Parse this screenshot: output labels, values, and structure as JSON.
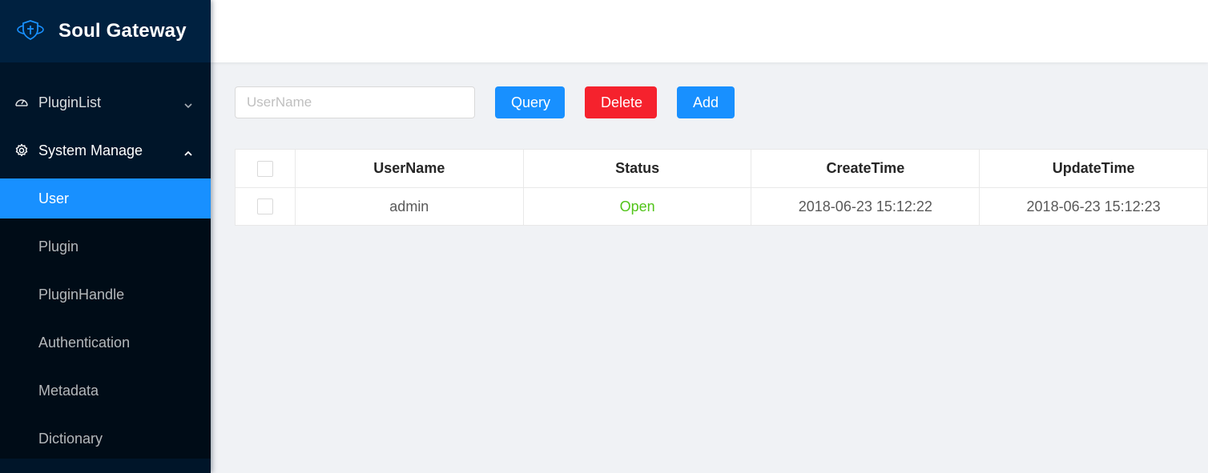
{
  "app": {
    "brand": "Soul Gateway"
  },
  "sidebar": {
    "menus": [
      {
        "label": "PluginList",
        "icon": "dashboard-icon",
        "expanded": false
      },
      {
        "label": "System Manage",
        "icon": "gear-icon",
        "expanded": true
      }
    ],
    "submenu": [
      {
        "label": "User",
        "active": true
      },
      {
        "label": "Plugin"
      },
      {
        "label": "PluginHandle"
      },
      {
        "label": "Authentication"
      },
      {
        "label": "Metadata"
      },
      {
        "label": "Dictionary"
      }
    ]
  },
  "toolbar": {
    "search_placeholder": "UserName",
    "search_value": "",
    "query_label": "Query",
    "delete_label": "Delete",
    "add_label": "Add"
  },
  "table": {
    "columns": [
      "UserName",
      "Status",
      "CreateTime",
      "UpdateTime"
    ],
    "rows": [
      {
        "username": "admin",
        "status": "Open",
        "create_time": "2018-06-23 15:12:22",
        "update_time": "2018-06-23 15:12:23"
      }
    ]
  },
  "colors": {
    "sidebar": "#001529",
    "primary": "#1890ff",
    "danger": "#f5222d",
    "status_open": "#52c41a"
  }
}
